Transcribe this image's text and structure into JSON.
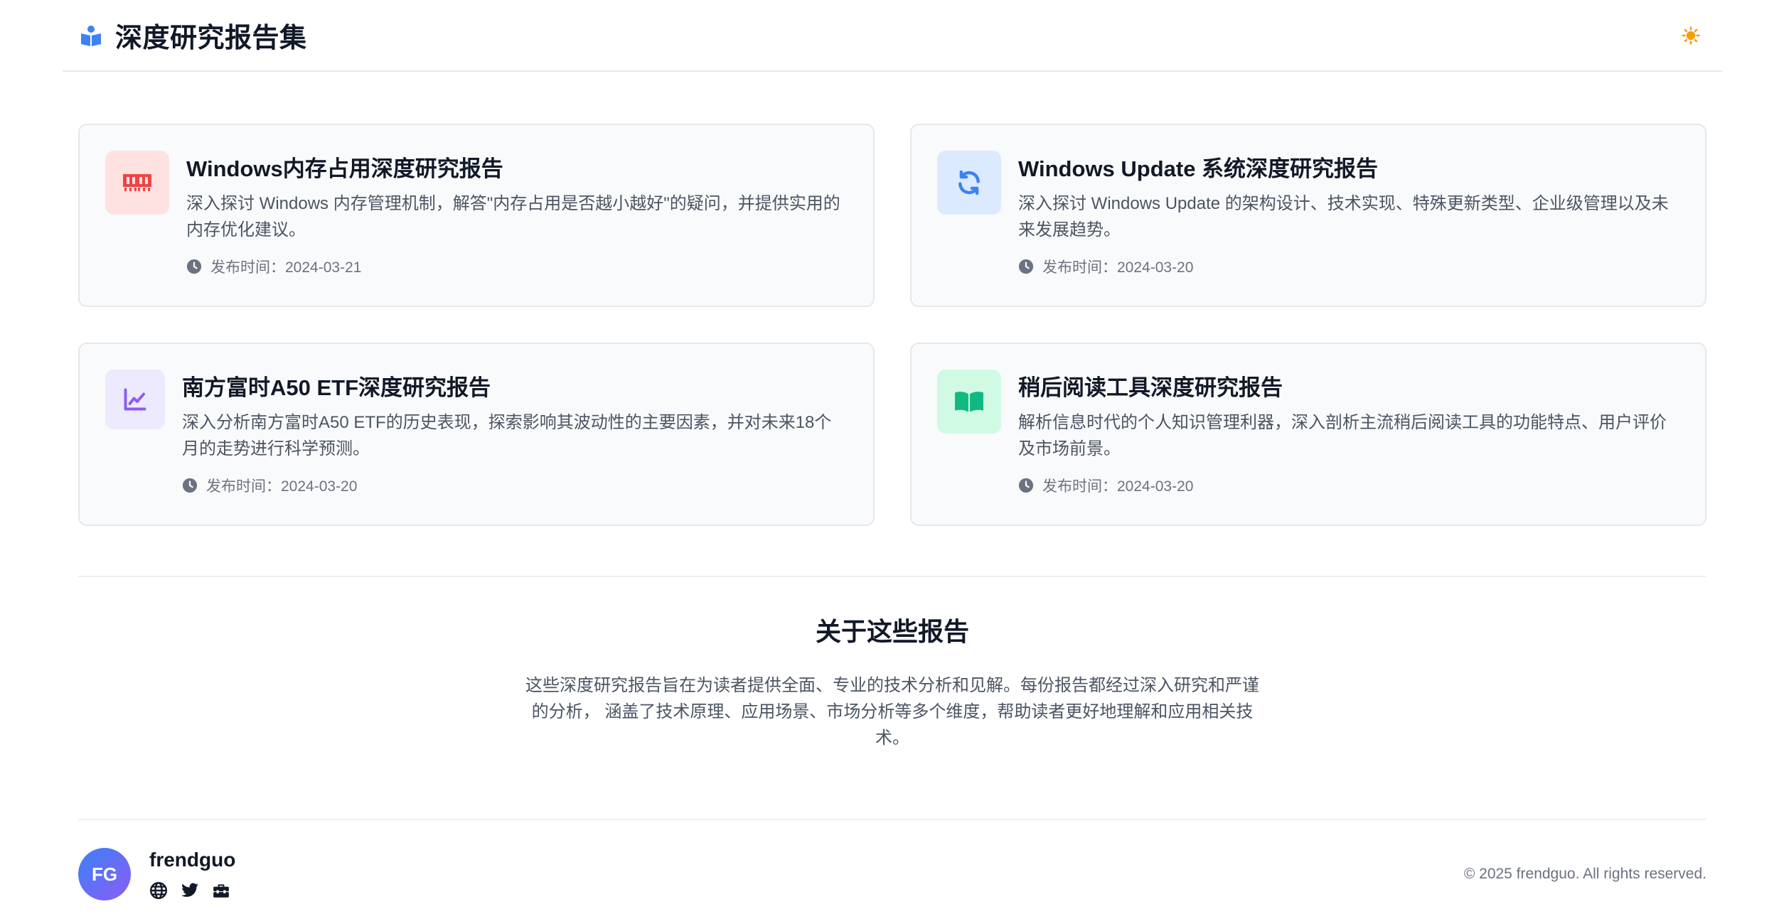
{
  "header": {
    "title": "深度研究报告集",
    "brand_icon": "book-reader-icon",
    "theme_icon": "sun-icon"
  },
  "reports": [
    {
      "title": "Windows内存占用深度研究报告",
      "description": "深入探讨 Windows 内存管理机制，解答\"内存占用是否越小越好\"的疑问，并提供实用的内存优化建议。",
      "date": "发布时间：2024-03-21",
      "icon": "memory-icon",
      "icon_color": "#ef4444",
      "icon_bg": "#fee2e2"
    },
    {
      "title": "Windows Update 系统深度研究报告",
      "description": "深入探讨 Windows Update 的架构设计、技术实现、特殊更新类型、企业级管理以及未来发展趋势。",
      "date": "发布时间：2024-03-20",
      "icon": "sync-icon",
      "icon_color": "#3b82f6",
      "icon_bg": "#dbeafe"
    },
    {
      "title": "南方富时A50 ETF深度研究报告",
      "description": "深入分析南方富时A50 ETF的历史表现，探索影响其波动性的主要因素，并对未来18个月的走势进行科学预测。",
      "date": "发布时间：2024-03-20",
      "icon": "chart-line-icon",
      "icon_color": "#8b5cf6",
      "icon_bg": "#ede9fe"
    },
    {
      "title": "稍后阅读工具深度研究报告",
      "description": "解析信息时代的个人知识管理利器，深入剖析主流稍后阅读工具的功能特点、用户评价及市场前景。",
      "date": "发布时间：2024-03-20",
      "icon": "book-open-icon",
      "icon_color": "#10b981",
      "icon_bg": "#d1fae5"
    }
  ],
  "about": {
    "title": "关于这些报告",
    "text": "这些深度研究报告旨在为读者提供全面、专业的技术分析和见解。每份报告都经过深入研究和严谨的分析， 涵盖了技术原理、应用场景、市场分析等多个维度，帮助读者更好地理解和应用相关技术。"
  },
  "footer": {
    "avatar_initials": "FG",
    "author": "frendguo",
    "socials": [
      "globe-icon",
      "twitter-icon",
      "toolbox-icon"
    ],
    "copyright": "© 2025 frendguo. All rights reserved."
  }
}
